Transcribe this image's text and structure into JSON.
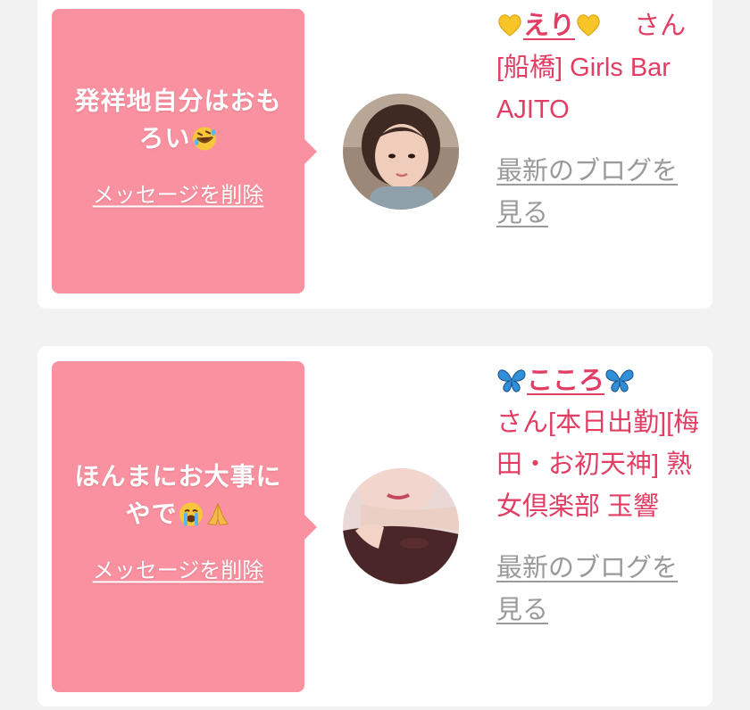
{
  "cards": [
    {
      "message_text": "発祥地自分はおもろい",
      "message_emoji": "rolling-on-floor-laughing-emoji",
      "delete_label": "メッセージを削除",
      "name": "えり",
      "name_emoji": "yellow-heart-emoji",
      "san": "さん",
      "shop": "[船橋] Girls Bar AJITO",
      "blog_label": "最新のブログを見る"
    },
    {
      "message_text": "ほんまにお大事にやで",
      "message_emoji": "loudly-crying-and-folded-hands-emoji",
      "delete_label": "メッセージを削除",
      "name": "こころ",
      "name_emoji": "blue-butterfly-emoji",
      "san": "さん",
      "shop": "[本日出勤][梅田・お初天神] 熟女倶楽部 玉響",
      "blog_label": "最新のブログを見る"
    }
  ],
  "colors": {
    "bubble": "#fa91a0",
    "accent": "#e23d63",
    "link_gray": "#9a9a9a",
    "card": "#ffffff",
    "background": "#f2f2f3"
  }
}
